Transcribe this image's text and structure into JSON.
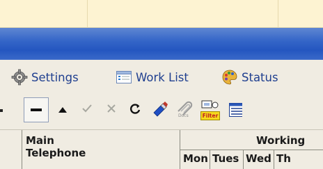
{
  "menu": {
    "settings_label": "Settings",
    "worklist_label": "Work List",
    "status_label": "Status"
  },
  "toolbar": {
    "buttons": [
      "delete-row",
      "move-up",
      "confirm",
      "cancel",
      "refresh",
      "edit",
      "attach",
      "filter",
      "list-view"
    ],
    "filter_badge": "Filter",
    "attach_badge": "Docs"
  },
  "grid": {
    "main_header": "Main\nTelephone",
    "working_header": "Working",
    "days": [
      "Mon",
      "Tues",
      "Wed",
      "Th"
    ]
  }
}
